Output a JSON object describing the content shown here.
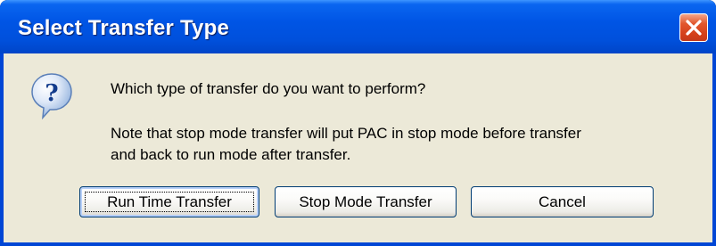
{
  "dialog": {
    "title": "Select Transfer Type",
    "close_icon": "close-icon",
    "message_icon": "question-icon",
    "question": "Which type of transfer do you want to perform?",
    "note_line1": "Note that stop mode transfer will put PAC in stop mode before transfer",
    "note_line2": "and back to run mode after transfer."
  },
  "buttons": {
    "run_time": "Run Time Transfer",
    "stop_mode": "Stop Mode Transfer",
    "cancel": "Cancel"
  },
  "colors": {
    "titlebar": "#0055e5",
    "client": "#ece9d8",
    "close": "#d4401a",
    "button_border": "#003c74"
  }
}
